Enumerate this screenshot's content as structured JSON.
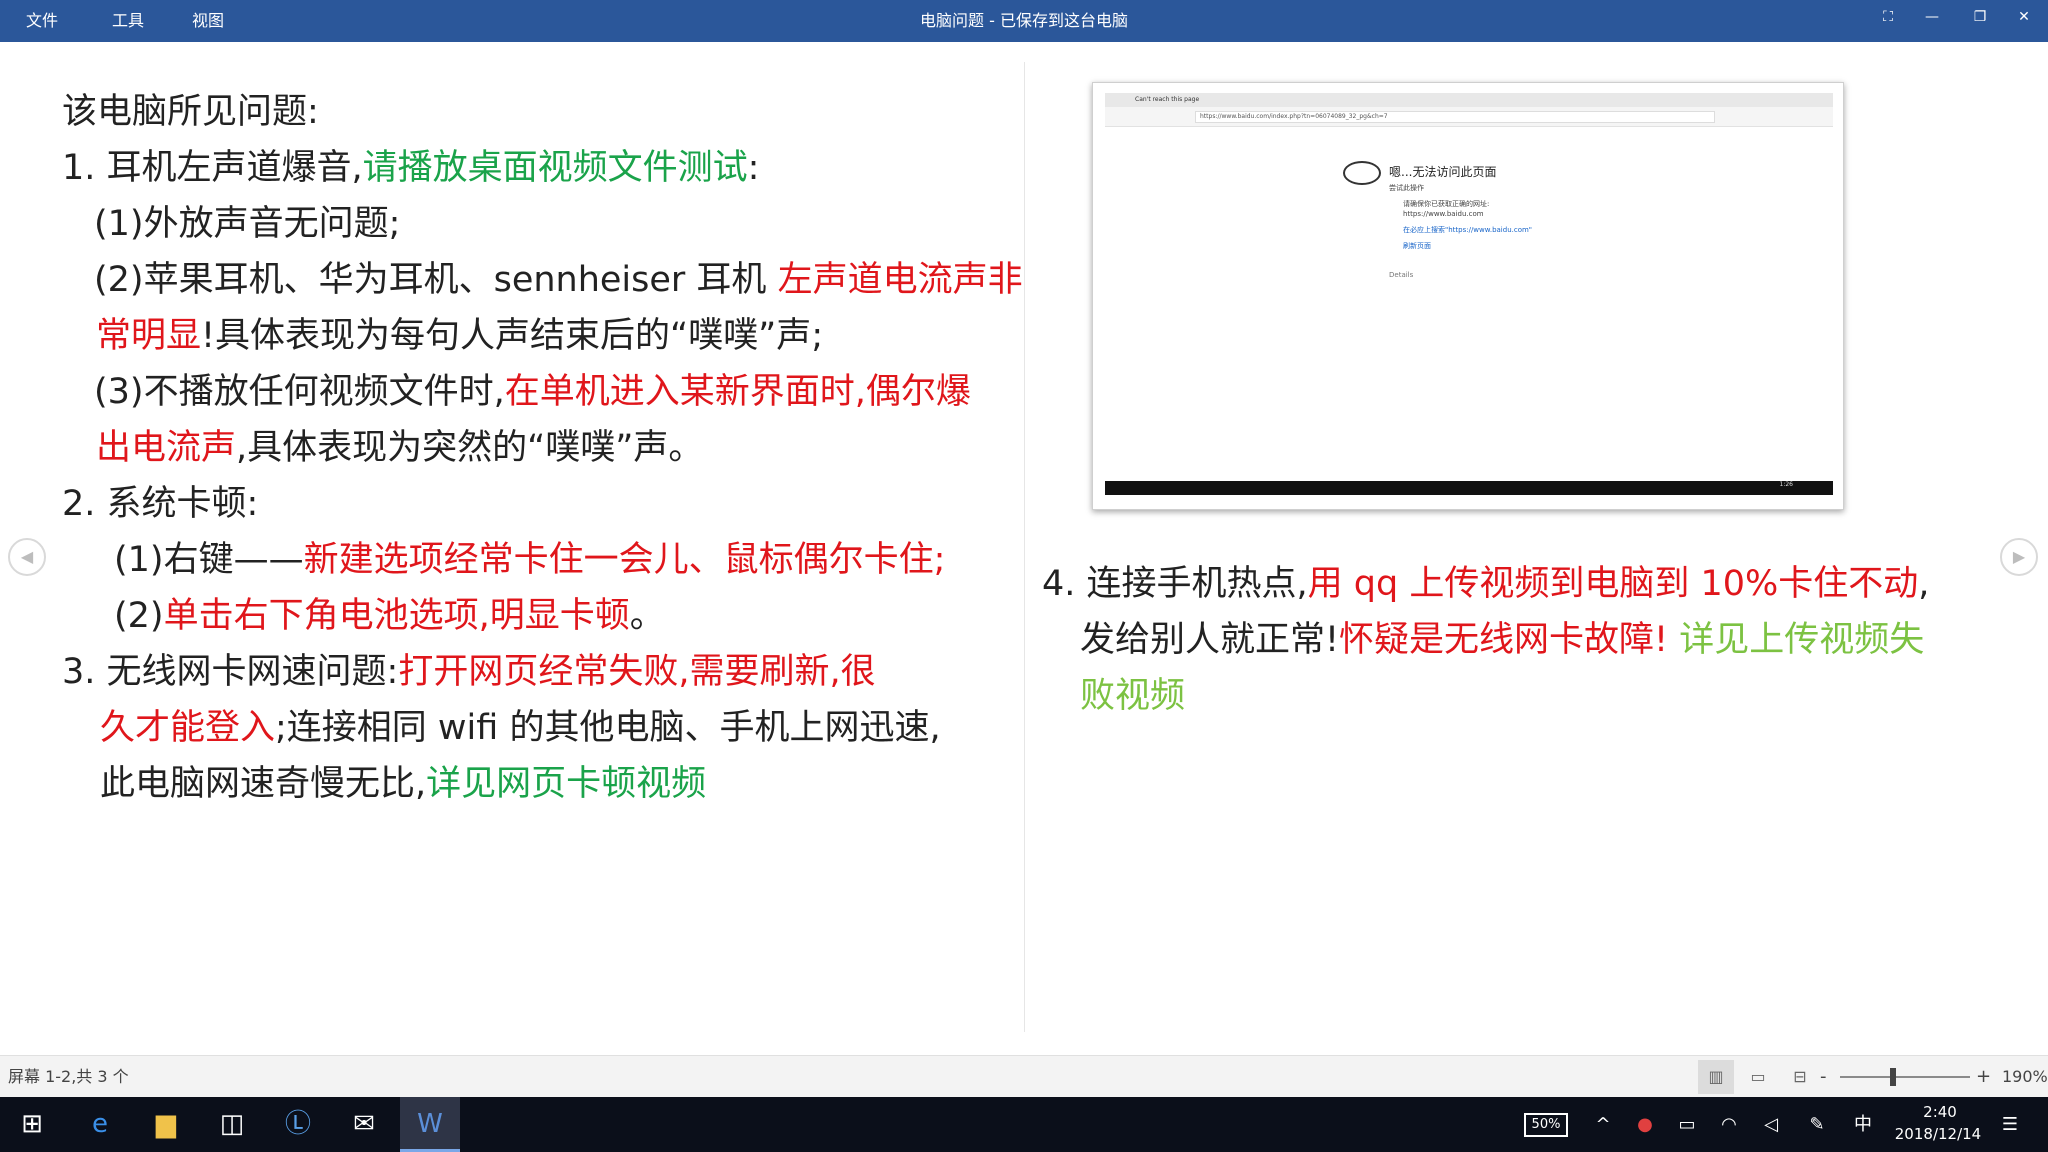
{
  "titlebar": {
    "menu": [
      "文件",
      "工具",
      "视图"
    ],
    "title": "电脑问题 - 已保存到这台电脑",
    "buttons": [
      "⛶",
      "—",
      "❐",
      "✕"
    ]
  },
  "document": {
    "left": {
      "heading": "该电脑所见问题:",
      "item1_prefix": "1. 耳机左声道爆音,",
      "item1_green": "请播放桌面视频文件测试",
      "item1_colon": ":",
      "item1_sub1": "(1)外放声音无问题;",
      "item1_sub2_prefix": "(2)苹果耳机、华为耳机、sennheiser 耳机",
      "item1_sub2_red_a": "左声道电流声非",
      "item1_sub2_red_b": "常明显",
      "item1_sub2_rest": "!具体表现为每句人声结束后的“噗噗”声;",
      "item1_sub3_prefix": "(3)不播放任何视频文件时,",
      "item1_sub3_red_a": "在单机进入某新界面时,偶尔爆",
      "item1_sub3_red_b": "出电流声",
      "item1_sub3_rest": ",具体表现为突然的“噗噗”声。",
      "item2": "2.   系统卡顿:",
      "item2_sub1_prefix": "(1)右键——",
      "item2_sub1_red": "新建选项经常卡住一会儿、鼠标偶尔卡住;",
      "item2_sub2_prefix": "(2)",
      "item2_sub2_red": "单击右下角电池选项,明显卡顿",
      "item2_sub2_end": "。",
      "item3_prefix": "3.   无线网卡网速问题:",
      "item3_red_a": "打开网页经常失败,需要刷新,很",
      "item3_red_b": "久才能登入",
      "item3_rest_a": ";连接相同 wifi 的其他电脑、手机上网迅速,",
      "item3_rest_b": "此电脑网速奇慢无比,",
      "item3_green": "详见网页卡顿视频"
    },
    "right": {
      "item4_prefix": "4.   连接手机热点,",
      "item4_red_a": "用 qq 上传视频到电脑到 10%卡住不动",
      "item4_comma": ",",
      "item4_rest": "发给别人就正常!",
      "item4_red_b": "怀疑是无线网卡故障!",
      "item4_lgreen_a": "详见上传视频失",
      "item4_lgreen_b": "败视频"
    },
    "embedded_screenshot": {
      "tab_label": "Can't reach this page",
      "address": "https://www.baidu.com/index.php?tn=06074089_32_pg&ch=7",
      "error_title": "嗯...无法访问此页面",
      "error_sub": "尝试此操作",
      "error_item1": "请确保你已获取正确的网址:",
      "error_item1_url": "https://www.baidu.com",
      "error_item2": "在必应上搜索\"https://www.baidu.com\"",
      "error_item3": "刷新页面",
      "details": "Details",
      "mini_time": "1:26"
    }
  },
  "statusbar": {
    "page_info": "屏幕 1-2,共 3 个",
    "zoom_minus": "-",
    "zoom_plus": "+",
    "zoom_level": "190%",
    "zoom_fraction": 0.41
  },
  "taskbar": {
    "battery": "50%",
    "battery_fraction": 0.5,
    "ime": "中",
    "time": "2:40",
    "date": "2018/12/14"
  },
  "colors": {
    "titlebar": "#2b579a",
    "green_text": "#1aa34a",
    "red_text": "#e0161b",
    "light_green_text": "#7cc242"
  }
}
